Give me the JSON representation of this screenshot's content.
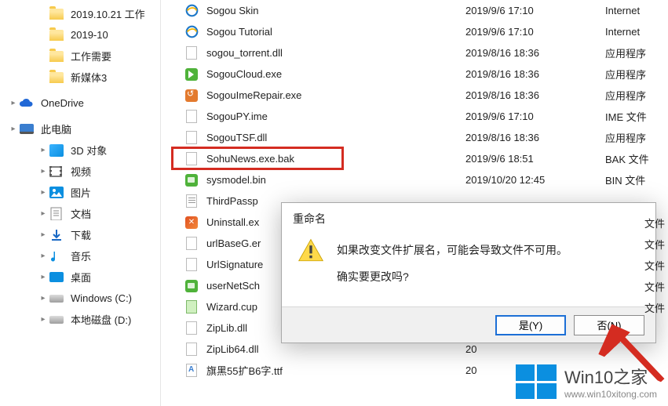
{
  "sidebar": {
    "items": [
      {
        "label": "2019.10.21 工作",
        "type": "folder",
        "indent": 1
      },
      {
        "label": "2019-10",
        "type": "folder",
        "indent": 1
      },
      {
        "label": "工作需要",
        "type": "folder",
        "indent": 1
      },
      {
        "label": "新媒体3",
        "type": "folder",
        "indent": 1
      },
      {
        "spacer": true
      },
      {
        "label": "OneDrive",
        "type": "onedrive",
        "indent": 0,
        "caret": true
      },
      {
        "spacer": true
      },
      {
        "label": "此电脑",
        "type": "pc",
        "indent": 0,
        "caret": true
      },
      {
        "label": "3D 对象",
        "type": "3d",
        "indent": 1,
        "caret": true
      },
      {
        "label": "视频",
        "type": "video",
        "indent": 1,
        "caret": true
      },
      {
        "label": "图片",
        "type": "pic",
        "indent": 1,
        "caret": true
      },
      {
        "label": "文档",
        "type": "doc",
        "indent": 1,
        "caret": true
      },
      {
        "label": "下载",
        "type": "download",
        "indent": 1,
        "caret": true
      },
      {
        "label": "音乐",
        "type": "music",
        "indent": 1,
        "caret": true
      },
      {
        "label": "桌面",
        "type": "desktop",
        "indent": 1,
        "caret": true
      },
      {
        "label": "Windows (C:)",
        "type": "drive",
        "indent": 1,
        "caret": true
      },
      {
        "label": "本地磁盘 (D:)",
        "type": "drive",
        "indent": 1,
        "caret": true
      }
    ]
  },
  "files": [
    {
      "name": "Sogou Skin",
      "date": "2019/9/6 17:10",
      "type": "Internet",
      "icon": "ie"
    },
    {
      "name": "Sogou Tutorial",
      "date": "2019/9/6 17:10",
      "type": "Internet",
      "icon": "ie"
    },
    {
      "name": "sogou_torrent.dll",
      "date": "2019/8/16 18:36",
      "type": "应用程序",
      "icon": "dll"
    },
    {
      "name": "SogouCloud.exe",
      "date": "2019/8/16 18:36",
      "type": "应用程序",
      "icon": "exe-green"
    },
    {
      "name": "SogouImeRepair.exe",
      "date": "2019/8/16 18:36",
      "type": "应用程序",
      "icon": "exe-orange"
    },
    {
      "name": "SogouPY.ime",
      "date": "2019/9/6 17:10",
      "type": "IME 文件",
      "icon": "blank"
    },
    {
      "name": "SogouTSF.dll",
      "date": "2019/8/16 18:36",
      "type": "应用程序",
      "icon": "dll"
    },
    {
      "name": "SohuNews.exe.bak",
      "date": "2019/9/6 18:51",
      "type": "BAK 文件",
      "icon": "blank",
      "highlight": true
    },
    {
      "name": "sysmodel.bin",
      "date": "2019/10/20 12:45",
      "type": "BIN 文件",
      "icon": "sys"
    },
    {
      "name": "ThirdPassp",
      "date": "",
      "type": "",
      "icon": "text"
    },
    {
      "name": "Uninstall.ex",
      "date": "",
      "type": "",
      "icon": "uninstall"
    },
    {
      "name": "urlBaseG.er",
      "date": "",
      "type": "",
      "icon": "blank"
    },
    {
      "name": "UrlSignature",
      "date": "",
      "type": "",
      "icon": "blank"
    },
    {
      "name": "userNetSch",
      "date": "",
      "type": "",
      "icon": "sys"
    },
    {
      "name": "Wizard.cup",
      "date": "",
      "type": "",
      "icon": "wiz"
    },
    {
      "name": "ZipLib.dll",
      "date": "20",
      "type": "",
      "icon": "dll"
    },
    {
      "name": "ZipLib64.dll",
      "date": "20",
      "type": "",
      "icon": "dll"
    },
    {
      "name": "旗黑55扩B6字.ttf",
      "date": "20",
      "type": "",
      "icon": "ttf"
    }
  ],
  "extra_type_markers": [
    "文件",
    "文件",
    "文件",
    "文件",
    "文件"
  ],
  "dialog": {
    "title": "重命名",
    "line1": "如果改变文件扩展名，可能会导致文件不可用。",
    "line2": "确实要更改吗?",
    "btn_yes": "是(Y)",
    "btn_no": "否(N)"
  },
  "watermark": {
    "title": "Win10之家",
    "url": "www.win10xitong.com"
  }
}
